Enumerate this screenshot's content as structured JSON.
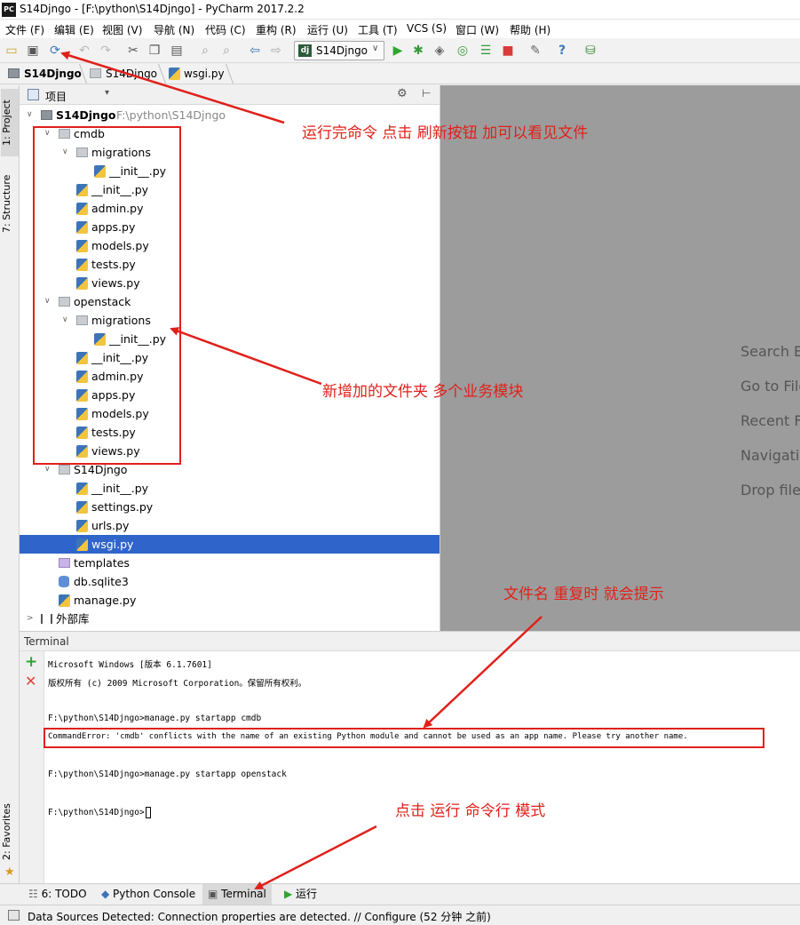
{
  "window": {
    "title": "S14Djngo - [F:\\python\\S14Djngo] - PyCharm 2017.2.2",
    "logo": "PC"
  },
  "menu": [
    "文件 (F)",
    "编辑 (E)",
    "视图 (V)",
    "导航 (N)",
    "代码 (C)",
    "重构 (R)",
    "运行 (U)",
    "工具 (T)",
    "VCS (S)",
    "窗口 (W)",
    "帮助 (H)"
  ],
  "toolbar": {
    "run_config": "S14Djngo",
    "run_config_badge": "dj",
    "icons": [
      "open-folder-icon",
      "save-icon",
      "sync-refresh-icon",
      "undo-icon",
      "redo-icon",
      "cut-icon",
      "copy-icon",
      "paste-icon",
      "find-icon",
      "replace-icon",
      "back-icon",
      "forward-icon",
      "run-icon",
      "debug-icon",
      "coverage-icon",
      "profile-icon",
      "concurrency-icon",
      "stop-icon",
      "settings-icon",
      "help-icon",
      "vcs-icon"
    ]
  },
  "breadcrumbs": [
    "S14Djngo",
    "S14Djngo",
    "wsgi.py"
  ],
  "project_pane": {
    "view_label": "项目",
    "tree": [
      {
        "label": "S14Djngo",
        "path": "F:\\python\\S14Djngo",
        "icon": "folder-root"
      },
      {
        "label": "cmdb",
        "icon": "folder"
      },
      {
        "label": "migrations",
        "icon": "folder"
      },
      {
        "label": "__init__.py",
        "icon": "python"
      },
      {
        "label": "__init__.py",
        "icon": "python"
      },
      {
        "label": "admin.py",
        "icon": "python"
      },
      {
        "label": "apps.py",
        "icon": "python"
      },
      {
        "label": "models.py",
        "icon": "python"
      },
      {
        "label": "tests.py",
        "icon": "python"
      },
      {
        "label": "views.py",
        "icon": "python"
      },
      {
        "label": "openstack",
        "icon": "folder"
      },
      {
        "label": "migrations",
        "icon": "folder"
      },
      {
        "label": "__init__.py",
        "icon": "python"
      },
      {
        "label": "__init__.py",
        "icon": "python"
      },
      {
        "label": "admin.py",
        "icon": "python"
      },
      {
        "label": "apps.py",
        "icon": "python"
      },
      {
        "label": "models.py",
        "icon": "python"
      },
      {
        "label": "tests.py",
        "icon": "python"
      },
      {
        "label": "views.py",
        "icon": "python"
      },
      {
        "label": "S14Djngo",
        "icon": "folder"
      },
      {
        "label": "__init__.py",
        "icon": "python"
      },
      {
        "label": "settings.py",
        "icon": "python"
      },
      {
        "label": "urls.py",
        "icon": "python"
      },
      {
        "label": "wsgi.py",
        "icon": "python",
        "selected": true
      },
      {
        "label": "templates",
        "icon": "folder-purple"
      },
      {
        "label": "db.sqlite3",
        "icon": "database"
      },
      {
        "label": "manage.py",
        "icon": "python"
      },
      {
        "label": "外部库",
        "icon": "library"
      }
    ]
  },
  "left_tool_tabs": [
    "1: Project",
    "7: Structure",
    "2: Favorites"
  ],
  "editor_hints": [
    "Search Ev",
    "Go to File",
    "Recent Fi",
    "Navigatio",
    "Drop files"
  ],
  "terminal": {
    "title": "Terminal",
    "lines": [
      "Microsoft Windows [版本 6.1.7601]",
      "版权所有 (c) 2009 Microsoft Corporation。保留所有权利。",
      "",
      "F:\\python\\S14Djngo>manage.py startapp cmdb",
      "CommandError: 'cmdb' conflicts with the name of an existing Python module and cannot be used as an app name. Please try another name.",
      "",
      "F:\\python\\S14Djngo>manage.py startapp openstack",
      "",
      "F:\\python\\S14Djngo>"
    ]
  },
  "bottom_tabs": [
    {
      "label": "6: TODO",
      "icon": "todo-icon"
    },
    {
      "label": "Python Console",
      "icon": "python-console-icon"
    },
    {
      "label": "Terminal",
      "icon": "terminal-icon",
      "active": true
    },
    {
      "label": "运行",
      "icon": "run-icon"
    }
  ],
  "status": "Data Sources Detected: Connection properties are detected. // Configure (52 分钟 之前)",
  "annotations": {
    "refresh": "运行完命令  点击    刷新按钮    加可以看见文件",
    "new_folders": "新增加的文件夹    多个业务模块",
    "duplicate_name": "文件名  重复时  就会提示",
    "terminal_mode": "点击  运行  命令行  模式",
    "color": "#e0201a"
  },
  "colors": {
    "selection": "#2f65ca",
    "editor_bg": "#9c9c9c",
    "run_green": "#2ea52e",
    "stop_red": "#d93b3b"
  }
}
